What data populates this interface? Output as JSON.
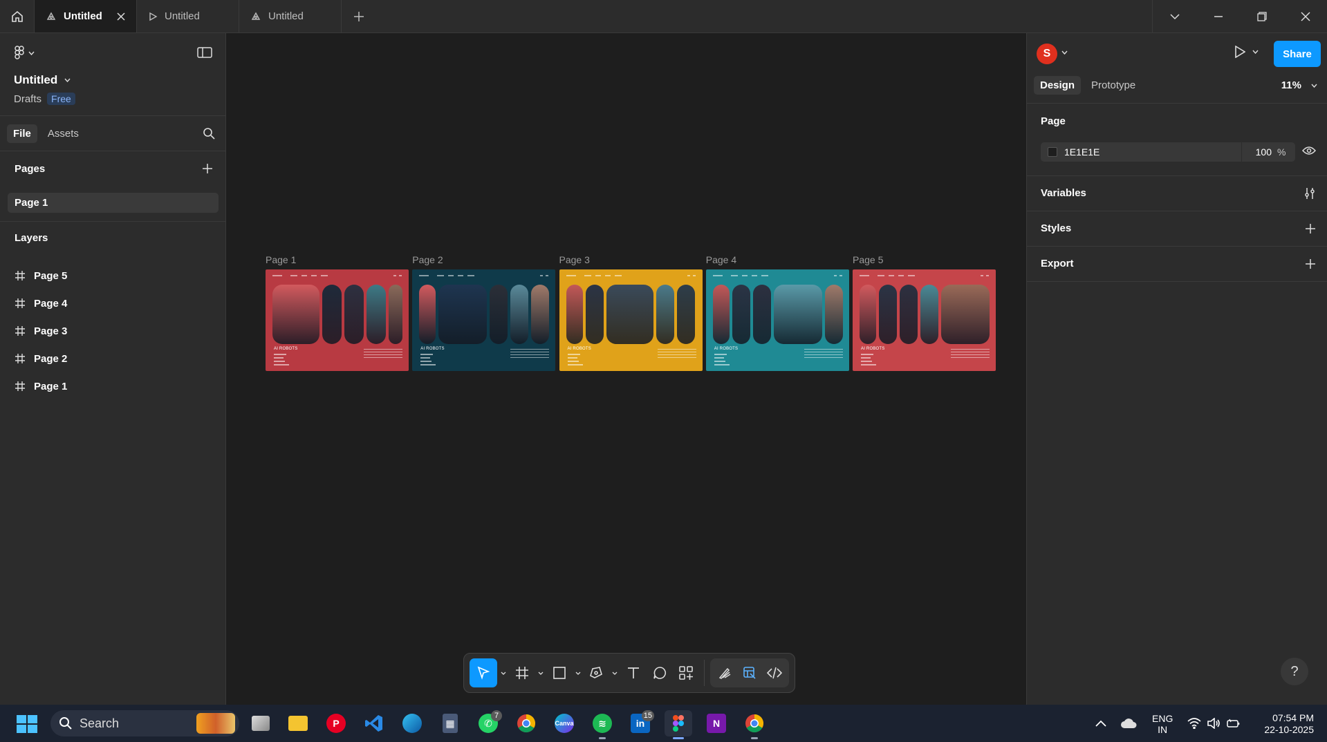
{
  "titlebar": {
    "tabs": [
      {
        "label": "Untitled",
        "active": true
      },
      {
        "label": "Untitled",
        "active": false
      },
      {
        "label": "Untitled",
        "active": false
      }
    ]
  },
  "left_panel": {
    "file_title": "Untitled",
    "drafts_label": "Drafts",
    "plan_badge": "Free",
    "tabs": {
      "file": "File",
      "assets": "Assets"
    },
    "pages_title": "Pages",
    "current_page": "Page 1",
    "layers_title": "Layers",
    "layers": [
      "Page 5",
      "Page 4",
      "Page 3",
      "Page 2",
      "Page 1"
    ]
  },
  "canvas": {
    "frames": [
      {
        "label": "Page 1",
        "bg": "#b83a42",
        "title": "AI ROBOTS"
      },
      {
        "label": "Page 2",
        "bg": "#0f3a4a",
        "title": "AI ROBOTS"
      },
      {
        "label": "Page 3",
        "bg": "#e0a21a",
        "title": "AI ROBOTS"
      },
      {
        "label": "Page 4",
        "bg": "#1f8a94",
        "title": "AI ROBOTS"
      },
      {
        "label": "Page 5",
        "bg": "#c5454a",
        "title": "AI ROBOTS"
      }
    ]
  },
  "right_panel": {
    "avatar_initial": "S",
    "share_label": "Share",
    "tabs": {
      "design": "Design",
      "prototype": "Prototype"
    },
    "zoom": "11%",
    "page_section": "Page",
    "page_color_hex": "1E1E1E",
    "page_opacity": "100",
    "page_opacity_unit": "%",
    "variables_title": "Variables",
    "styles_title": "Styles",
    "export_title": "Export",
    "help": "?"
  },
  "taskbar": {
    "search_placeholder": "Search",
    "whatsapp_badge": "7",
    "linkedin_badge": "15",
    "lang_primary": "ENG",
    "lang_secondary": "IN",
    "time": "07:54 PM",
    "date": "22-10-2025"
  },
  "colors": {
    "accent": "#0d99ff",
    "panel": "#2c2c2c",
    "canvas": "#1e1e1e",
    "avatar": "#e0301e"
  }
}
